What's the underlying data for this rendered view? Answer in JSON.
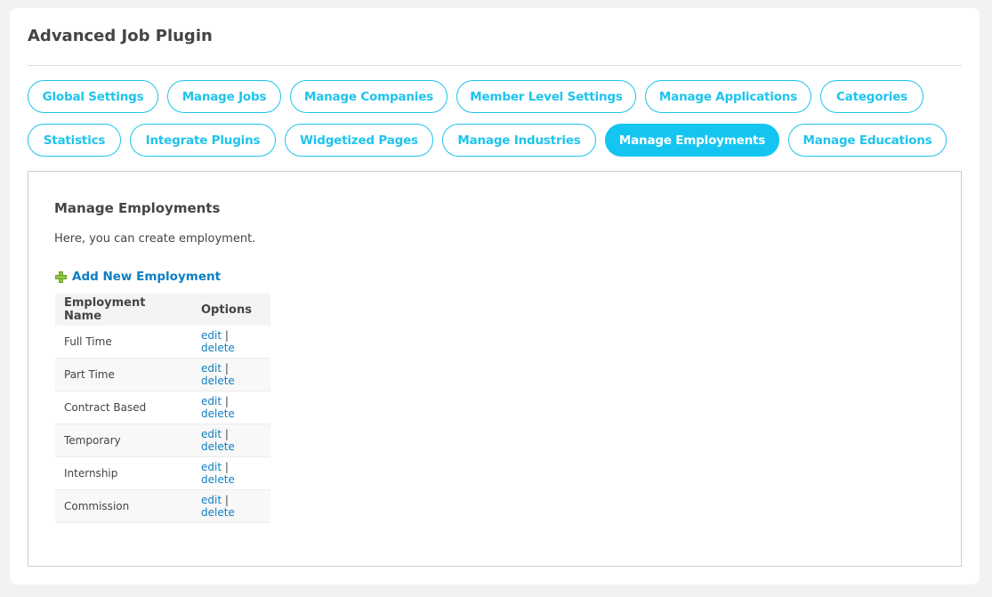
{
  "title": "Advanced Job Plugin",
  "tabs_row1": [
    "Global Settings",
    "Manage Jobs",
    "Manage Companies",
    "Member Level Settings",
    "Manage Applications",
    "Categories"
  ],
  "tabs_row2": [
    "Statistics",
    "Integrate Plugins",
    "Widgetized Pages",
    "Manage Industries",
    "Manage Employments",
    "Manage Educations"
  ],
  "active_tab": "Manage Employments",
  "accent": "#14c5f1",
  "main": {
    "heading": "Manage Employments",
    "description": "Here, you can create employment.",
    "add_label": "Add New Employment",
    "add_icon": "plus-icon",
    "columns": [
      "Employment Name",
      "Options"
    ],
    "rows": [
      "Full Time",
      "Part Time",
      "Contract Based",
      "Temporary",
      "Internship",
      "Commission"
    ],
    "edit_label": "edit",
    "separator": "|",
    "delete_label": "delete"
  }
}
